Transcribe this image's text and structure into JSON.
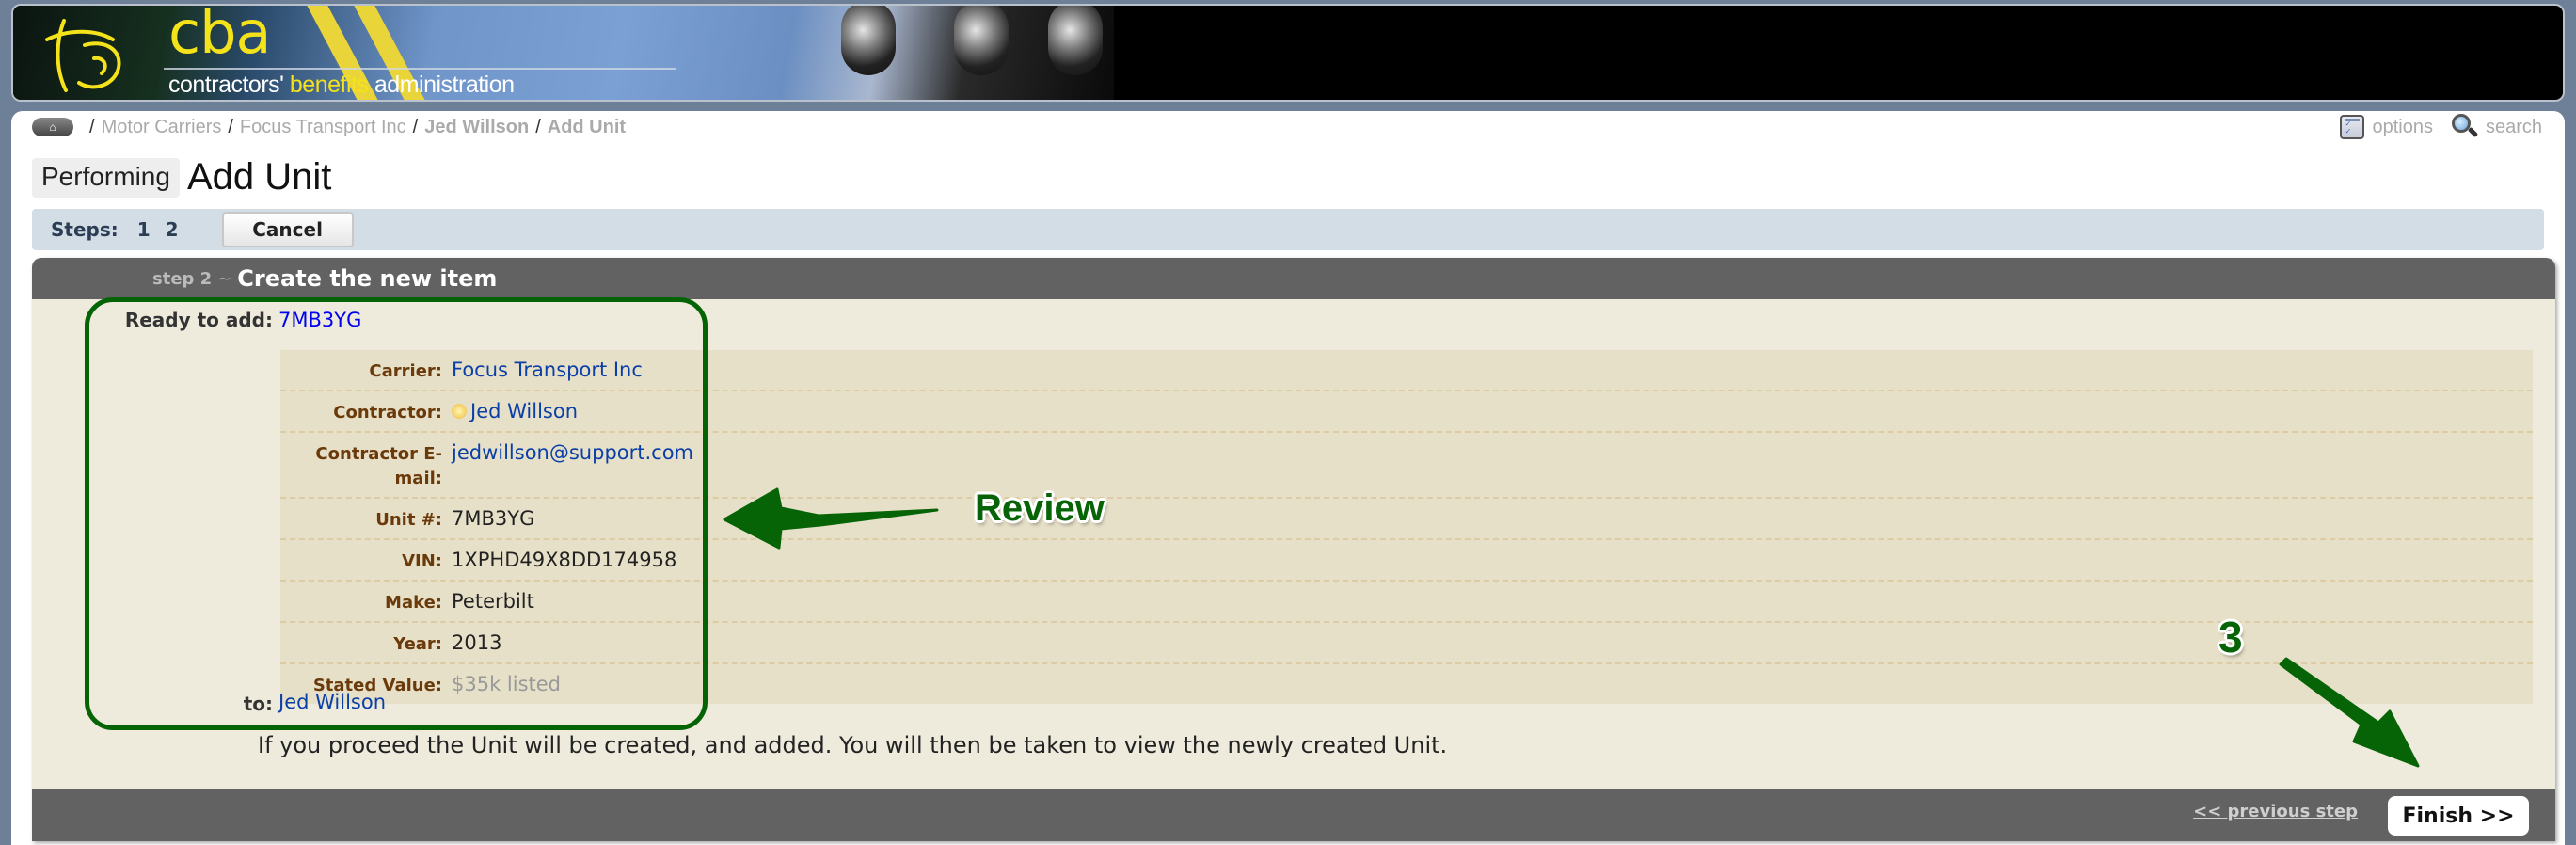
{
  "header": {
    "logo_text": "cba",
    "tagline_pre": "contractors' ",
    "tagline_highlight": "benefits",
    "tagline_post": " administration"
  },
  "breadcrumb": {
    "home_icon": "home-icon",
    "items": [
      {
        "label": "Motor Carriers",
        "bold": false
      },
      {
        "label": "Focus Transport Inc",
        "bold": false
      },
      {
        "label": "Jed Willson",
        "bold": true
      },
      {
        "label": "Add Unit",
        "bold": true
      }
    ],
    "separator": "/"
  },
  "tools": {
    "options_label": "options",
    "search_label": "search"
  },
  "title": {
    "prefix": "Performing",
    "main": "Add Unit"
  },
  "steps": {
    "label": "Steps:",
    "items": [
      "1",
      "2"
    ],
    "cancel_label": "Cancel"
  },
  "wizard": {
    "step_label": "step 2",
    "separator": "~",
    "title": "Create the new item",
    "ready_label": "Ready to add:",
    "ready_value": "7MB3YG",
    "details": [
      {
        "label": "Carrier:",
        "value": "Focus Transport Inc",
        "style": "link"
      },
      {
        "label": "Contractor:",
        "value": "Jed Willson",
        "style": "link",
        "icon": "status-dot-icon"
      },
      {
        "label": "Contractor E-mail:",
        "value": "jedwillson@support.com",
        "style": "link"
      },
      {
        "label": "Unit #:",
        "value": "7MB3YG",
        "style": "plain"
      },
      {
        "label": "VIN:",
        "value": "1XPHD49X8DD174958",
        "style": "plain"
      },
      {
        "label": "Make:",
        "value": "Peterbilt",
        "style": "plain"
      },
      {
        "label": "Year:",
        "value": "2013",
        "style": "plain"
      },
      {
        "label": "Stated Value:",
        "value": "$35k listed",
        "style": "muted"
      }
    ],
    "to_label": "to:",
    "to_value": "Jed Willson",
    "proceed_text": "If you proceed the Unit will be created, and added. You will then be taken to view the newly created Unit.",
    "previous_label": "<< previous step",
    "finish_label": "Finish >>"
  },
  "annotations": {
    "review_text": "Review",
    "step_number": "3",
    "color": "#066406"
  }
}
